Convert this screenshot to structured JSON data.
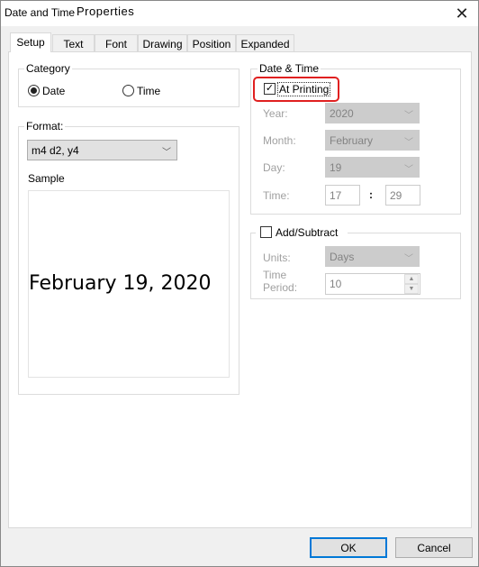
{
  "window": {
    "title_left": "Date and Time",
    "title_right": "Properties",
    "close_icon": "close-icon"
  },
  "tabs": [
    {
      "label": "Setup",
      "active": true
    },
    {
      "label": "Text"
    },
    {
      "label": "Font"
    },
    {
      "label": "Drawing"
    },
    {
      "label": "Position"
    },
    {
      "label": "Expanded"
    }
  ],
  "category": {
    "label": "Category",
    "options": [
      {
        "label": "Date",
        "selected": true
      },
      {
        "label": "Time",
        "selected": false
      }
    ]
  },
  "format": {
    "label": "Format:",
    "value": "m4 d2, y4",
    "sample_label": "Sample",
    "sample_text": "February 19, 2020"
  },
  "date_time": {
    "label": "Date & Time",
    "at_printing": {
      "label": "At Printing",
      "checked": true,
      "highlight_color": "#e02020"
    },
    "year": {
      "label": "Year:",
      "value": "2020"
    },
    "month": {
      "label": "Month:",
      "value": "February"
    },
    "day": {
      "label": "Day:",
      "value": "19"
    },
    "time": {
      "label": "Time:",
      "hour": "17",
      "separator": ":",
      "minute": "29"
    }
  },
  "add_subtract": {
    "label": "Add/Subtract",
    "checked": false,
    "units": {
      "label": "Units:",
      "value": "Days"
    },
    "period": {
      "label_line1": "Time",
      "label_line2": "Period:",
      "value": "10"
    }
  },
  "buttons": {
    "ok": "OK",
    "cancel": "Cancel"
  }
}
